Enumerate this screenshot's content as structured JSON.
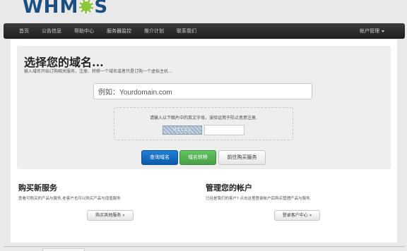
{
  "logo": {
    "text_before": "WHM",
    "text_after": "S"
  },
  "nav": {
    "items": [
      {
        "label": "首页"
      },
      {
        "label": "公告信息"
      },
      {
        "label": "帮助中心"
      },
      {
        "label": "服务器监控"
      },
      {
        "label": "推介计划"
      },
      {
        "label": "联系我们"
      }
    ],
    "account_label": "帐户管理"
  },
  "hero": {
    "title": "选择您的域名...",
    "subtitle": "输入域名开始订购相关服务，注册、转移一个域名或者只是订购一个虚拟主机...",
    "domain_input": {
      "value": "例如：Yourdomain.com",
      "placeholder": "例如：Yourdomain.com"
    },
    "captcha": {
      "instruction": "请输入以下图片中的英文字母，该验证用于防止恶意注册.",
      "image_text": "W3SDV",
      "input_value": ""
    },
    "buttons": {
      "search": "查询域名",
      "transfer": "域名转移",
      "buy": "前往购买服务"
    }
  },
  "services": {
    "title": "购买新服务",
    "desc": "查看可购买的产品与服务,老客户也可以购买产品与增值服务",
    "button": "购买其他服务 »"
  },
  "account": {
    "title": "管理您的帐户",
    "desc": "已经是我们的客户? 点击这里登录帐户后购买管理产品与服务.",
    "button": "登录客户中心 »"
  },
  "colors": {
    "navbar_bg": "#2b2b2b",
    "logo_blue": "#1b4f82",
    "logo_green": "#8cc63f",
    "btn_primary": "#0e63b8",
    "btn_success": "#51a351"
  }
}
